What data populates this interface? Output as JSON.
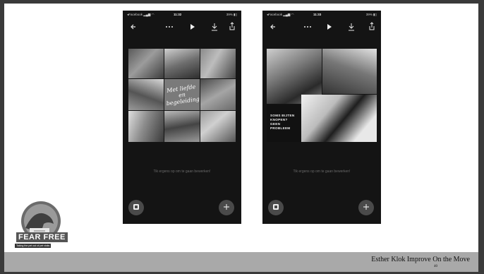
{
  "footer": {
    "text": "Esther Klok   Improve On the Move",
    "page": "40"
  },
  "phones": [
    {
      "status": {
        "carrier": "◂Facebook ▂▄▆ ◠",
        "time": "11:32",
        "battery": "39% ▮▯"
      },
      "toolbar": {
        "back_icon": "back-arrow-icon",
        "more_icon": "more-dots-icon",
        "play_icon": "play-icon",
        "download_icon": "download-icon",
        "share_icon": "share-icon"
      },
      "caption": "Met liefde en begeleiding",
      "hint": "Tik ergens op om te gaan bewerken!",
      "left_button_icon": "collage-icon",
      "right_button_icon": "plus-icon"
    },
    {
      "status": {
        "carrier": "◂Facebook ▂▄▆ ◠",
        "time": "11:33",
        "battery": "39% ▮▯"
      },
      "toolbar": {
        "back_icon": "back-arrow-icon",
        "more_icon": "more-dots-icon",
        "play_icon": "play-icon",
        "download_icon": "download-icon",
        "share_icon": "share-icon"
      },
      "quote": "SOMS BIJTEN KNOPEN? GEEN PROBLEEM",
      "hint": "Tik ergens op om te gaan bewerken!",
      "left_button_icon": "collage-icon",
      "right_button_icon": "plus-icon"
    }
  ],
  "logo": {
    "text": "FEAR FREE",
    "tagline": "Taking the pet out of pet visits"
  },
  "colors": {
    "phone_bg": "#141414",
    "footer_bg": "#a9a9a9",
    "slide_bg": "#ffffff"
  }
}
